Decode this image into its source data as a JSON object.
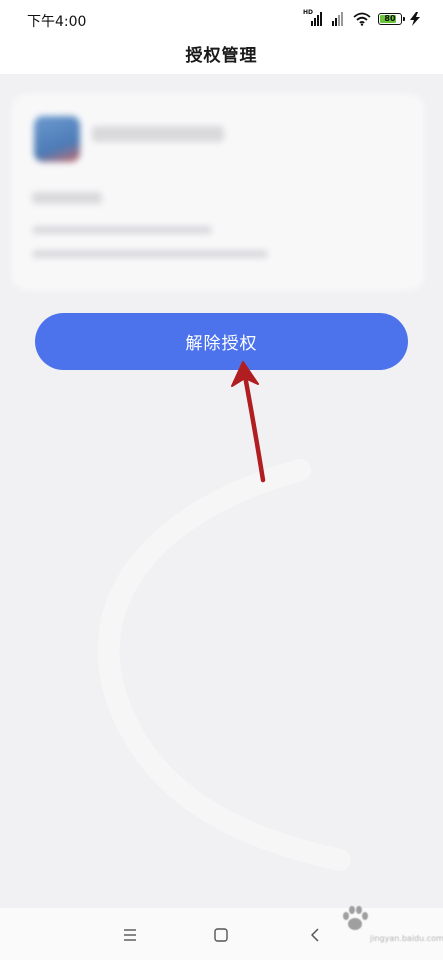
{
  "status_bar": {
    "time": "下午4:00",
    "network_label": "HD",
    "battery_level": "80",
    "battery_percent": 80,
    "icons": [
      "signal-hd-icon",
      "signal-icon",
      "wifi-icon",
      "battery-icon",
      "charging-icon"
    ]
  },
  "header": {
    "title": "授权管理"
  },
  "card": {
    "content_blurred": true
  },
  "action": {
    "revoke_label": "解除授权"
  },
  "colors": {
    "accent": "#4d73ec",
    "arrow": "#b01e22",
    "background": "#f1f1f3"
  },
  "nav": {
    "icons": [
      "menu-icon",
      "home-icon",
      "back-icon"
    ]
  },
  "watermark": {
    "text": "jingyan.baidu.com"
  }
}
